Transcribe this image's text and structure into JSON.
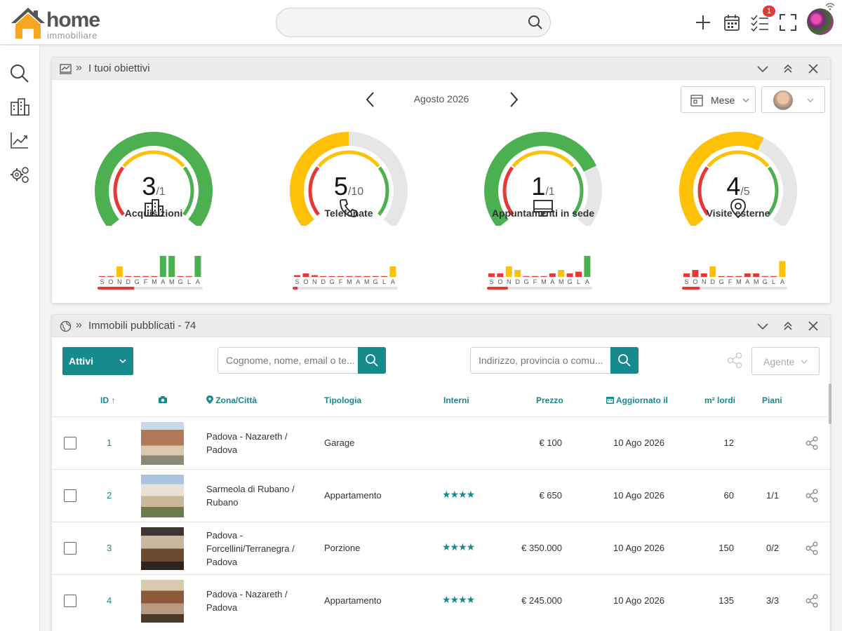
{
  "app": {
    "logo_main": "home",
    "logo_sub": "immobiliare",
    "search_placeholder": "",
    "notifications_count": "1"
  },
  "colors": {
    "accent": "#178a8d",
    "green": "#4caf50",
    "yellow": "#ffc107",
    "red": "#e53935",
    "track": "#e6e6e6"
  },
  "sidebar": {
    "items": [
      {
        "icon": "search-icon"
      },
      {
        "icon": "buildings-icon"
      },
      {
        "icon": "trend-chart-icon"
      },
      {
        "icon": "gears-icon"
      }
    ]
  },
  "objectives": {
    "title": "I tuoi obiettivi",
    "separator": "»",
    "month": "Agosto 2026",
    "period_select": "Mese",
    "gauges": [
      {
        "name": "Acquisizioni",
        "value": "3",
        "target": "/1",
        "icon": "buildings-icon",
        "fill_fraction": 1.0,
        "fill_color": "#4caf50",
        "bars": [
          0,
          0,
          6,
          0,
          0,
          0,
          0,
          12,
          12,
          0,
          0,
          12
        ],
        "bar_colors": [
          "#e53935",
          "#e53935",
          "#ffc107",
          "#e53935",
          "#e53935",
          "#e53935",
          "#e53935",
          "#4caf50",
          "#4caf50",
          "#e53935",
          "#e53935",
          "#4caf50"
        ],
        "progress": 0.35
      },
      {
        "name": "Telefonate",
        "value": "5",
        "target": "/10",
        "icon": "phone-icon",
        "fill_fraction": 0.5,
        "fill_color": "#ffc107",
        "bars": [
          1,
          2,
          1,
          0,
          0,
          0,
          0,
          0,
          0,
          0,
          0,
          6
        ],
        "bar_colors": [
          "#e53935",
          "#e53935",
          "#e53935",
          "#e53935",
          "#e53935",
          "#e53935",
          "#e53935",
          "#e53935",
          "#e53935",
          "#e53935",
          "#e53935",
          "#ffc107"
        ],
        "progress": 0.05
      },
      {
        "name": "Appuntamenti in sede",
        "value": "1",
        "target": "/1",
        "icon": "monitor-icon",
        "fill_fraction": 0.75,
        "fill_color": "#4caf50",
        "bars": [
          2,
          2,
          6,
          4,
          0,
          0,
          0,
          2,
          4,
          2,
          3,
          12
        ],
        "bar_colors": [
          "#e53935",
          "#e53935",
          "#ffc107",
          "#ffc107",
          "#e53935",
          "#e53935",
          "#e53935",
          "#e53935",
          "#ffc107",
          "#e53935",
          "#e53935",
          "#4caf50"
        ],
        "progress": 0.2
      },
      {
        "name": "Visite esterne",
        "value": "4",
        "target": "/5",
        "icon": "location-pin-icon",
        "fill_fraction": 0.6,
        "fill_color": "#ffc107",
        "bars": [
          2,
          4,
          2,
          6,
          0,
          0,
          0,
          2,
          2,
          0,
          0,
          9
        ],
        "bar_colors": [
          "#e53935",
          "#e53935",
          "#e53935",
          "#ffc107",
          "#e53935",
          "#e53935",
          "#e53935",
          "#e53935",
          "#e53935",
          "#e53935",
          "#e53935",
          "#ffc107"
        ],
        "progress": 0.17
      }
    ],
    "month_letters": [
      "S",
      "O",
      "N",
      "D",
      "G",
      "F",
      "M",
      "A",
      "M",
      "G",
      "L",
      "A"
    ]
  },
  "listing": {
    "title": "Immobili pubblicati - 74",
    "separator": "»",
    "status_filter": "Attivi",
    "search1_placeholder": "Cognome, nome, email o te...",
    "search2_placeholder": "Indirizzo, provincia o comu...",
    "agent_filter": "Agente",
    "columns": {
      "id": "ID ↑",
      "photo": "camera-icon",
      "zone": "Zona/Città",
      "type": "Tipologia",
      "interni": "Interni",
      "price": "Prezzo",
      "updated": "Aggiornato il",
      "sqm": "m² lordi",
      "floors": "Piani"
    },
    "rows": [
      {
        "id": "1",
        "zone_lines": [
          "Padova - Nazareth /",
          "Padova"
        ],
        "type": "Garage",
        "stars": "",
        "price": "€ 100",
        "updated": "10 Ago 2026",
        "sqm": "12",
        "floors": ""
      },
      {
        "id": "2",
        "zone_lines": [
          "Sarmeola di Rubano /",
          "Rubano"
        ],
        "type": "Appartamento",
        "stars": "★★★★",
        "price": "€ 650",
        "updated": "10 Ago 2026",
        "sqm": "60",
        "floors": "1/1"
      },
      {
        "id": "3",
        "zone_lines": [
          "Padova -",
          "Forcellini/Terranegra /",
          "Padova"
        ],
        "type": "Porzione",
        "stars": "★★★★",
        "price": "€ 350.000",
        "updated": "10 Ago 2026",
        "sqm": "150",
        "floors": "0/2"
      },
      {
        "id": "4",
        "zone_lines": [
          "Padova - Nazareth /",
          "Padova"
        ],
        "type": "Appartamento",
        "stars": "★★★★",
        "price": "€ 245.000",
        "updated": "10 Ago 2026",
        "sqm": "135",
        "floors": "3/3"
      }
    ]
  }
}
